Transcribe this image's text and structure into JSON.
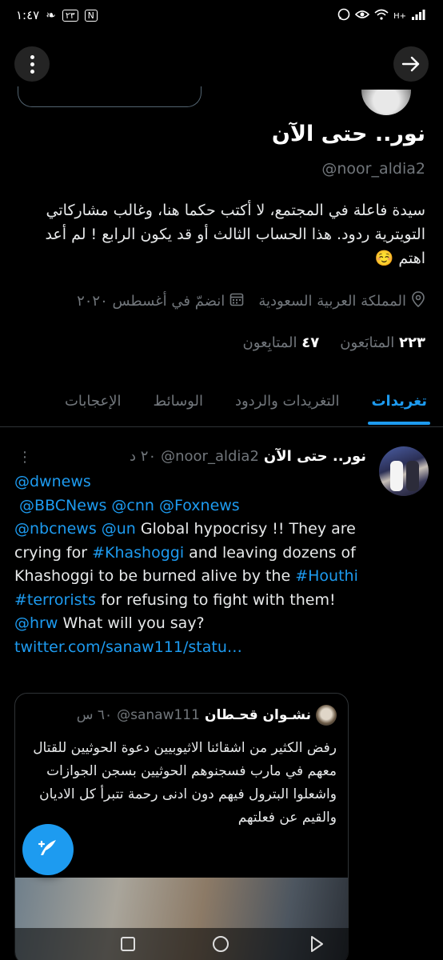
{
  "status_bar": {
    "time": "١:٤٧",
    "notification_badge": "٢٣",
    "network_label": "H+",
    "icons": [
      "whatsapp-icon",
      "eye-icon",
      "wifi-icon",
      "signal-icon",
      "nfc-icon",
      "leaf-icon"
    ]
  },
  "top_nav": {
    "more_icon": "kebab-menu-icon",
    "forward_icon": "arrow-right-icon"
  },
  "profile": {
    "display_name": "نور.. حتى الآن",
    "handle": "@noor_aldia2",
    "bio": "سيدة فاعلة في المجتمع، لا أكتب حكما هنا، وغالب مشاركاتي التويترية ردود. هذا الحساب الثالث أو قد يكون الرابع ! لم أعد اهتم ☺️",
    "location": "المملكة العربية السعودية",
    "joined": "انضمّ في أغسطس ٢٠٢٠",
    "following_count": "٢٢٣",
    "following_label": "المتابَعون",
    "followers_count": "٤٧",
    "followers_label": "المتابِعون"
  },
  "tabs": [
    {
      "label": "تغريدات",
      "active": true
    },
    {
      "label": "التغريدات والردود",
      "active": false
    },
    {
      "label": "الوسائط",
      "active": false
    },
    {
      "label": "الإعجابات",
      "active": false
    }
  ],
  "tweet": {
    "author_name": "نور.. حتى الآن",
    "author_handle": "@noor_aldia2",
    "time": "٢٠ د",
    "mentions_line1": "@dwnews",
    "mentions_line2": "@BBCNews @cnn @Foxnews",
    "mention_nbc": "@nbcnews @un",
    "text_1": " Global hypocrisy !! They are crying for ",
    "hashtag_khashoggi": "#Khashoggi",
    "text_2": " and leaving dozens of Khashoggi to be burned alive by the ",
    "hashtag_houthi": "#Houthi",
    "hashtag_terrorists": "#terrorists",
    "text_3": " for refusing to fight with them!",
    "mention_hrw": "@hrw",
    "text_4": " What will you say?",
    "link": "twitter.com/sanaw111/statu…"
  },
  "quoted_tweet": {
    "author_name": "نشـوان قحـطان",
    "author_handle": "@sanaw111",
    "time": "٦٠ س",
    "text": "رفض الكثير من اشقائنا الاثيوبيين دعوة الحوثيين للقتال معهم في مارب فسجنوهم الحوثيين بسجن الجوازات واشعلوا البترول فيهم دون ادنى رحمة تتبرأ كل الاديان والقيم عن فعلتهم"
  },
  "fab": {
    "icon": "compose-tweet-icon"
  },
  "nav_bar": {
    "icons": [
      "recents-icon",
      "home-icon",
      "back-icon"
    ]
  },
  "colors": {
    "accent": "#1d9bf0",
    "background": "#000000",
    "secondary_text": "#71767b"
  }
}
